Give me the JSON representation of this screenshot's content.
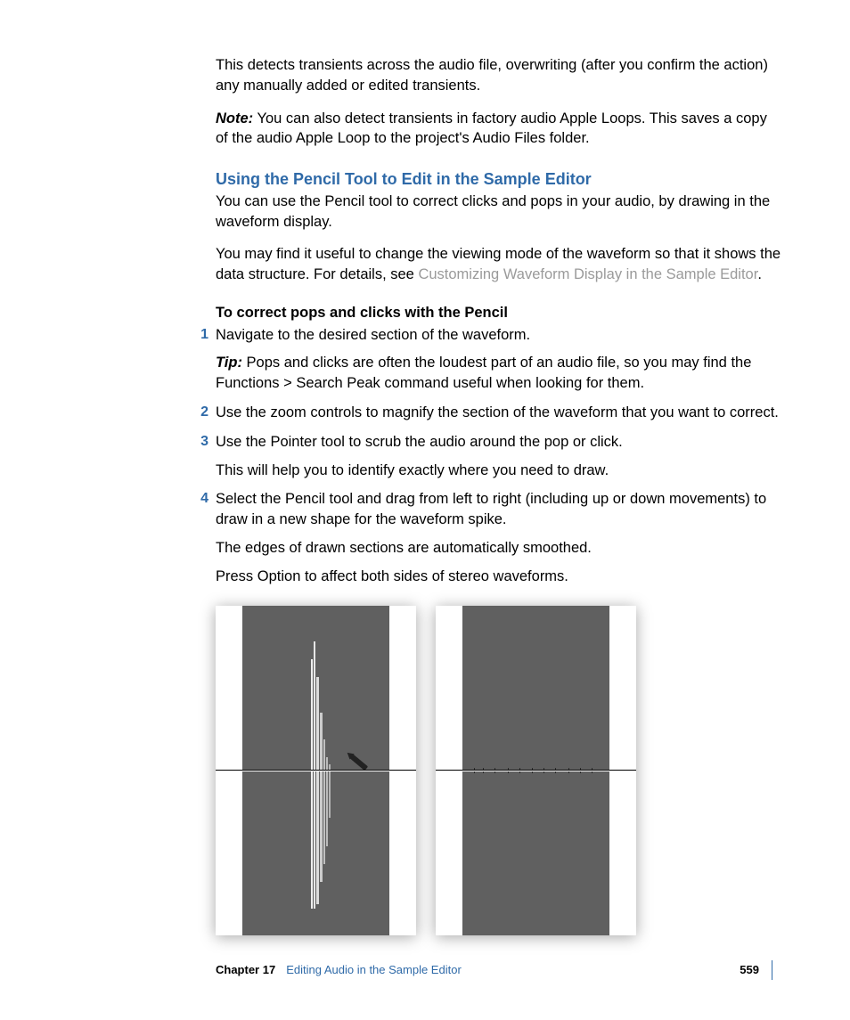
{
  "intro_para": "This detects transients across the audio file, overwriting (after you confirm the action) any manually added or edited transients.",
  "note": {
    "label": "Note:",
    "text": " You can also detect transients in factory audio Apple Loops. This saves a copy of the audio Apple Loop to the project's Audio Files folder."
  },
  "section_heading": "Using the Pencil Tool to Edit in the Sample Editor",
  "section_p1": "You can use the Pencil tool to correct clicks and pops in your audio, by drawing in the waveform display.",
  "section_p2_a": "You may find it useful to change the viewing mode of the waveform so that it shows the data structure. For details, see ",
  "section_p2_link": "Customizing Waveform Display in the Sample Editor",
  "section_p2_b": ".",
  "sub_heading": "To correct pops and clicks with the Pencil",
  "steps": [
    {
      "text": "Navigate to the desired section of the waveform.",
      "extras": [
        {
          "tip_label": "Tip:",
          "text": " Pops and clicks are often the loudest part of an audio file, so you may find the Functions > Search Peak command useful when looking for them."
        }
      ]
    },
    {
      "text": "Use the zoom controls to magnify the section of the waveform that you want to correct."
    },
    {
      "text": "Use the Pointer tool to scrub the audio around the pop or click.",
      "extras": [
        {
          "text": "This will help you to identify exactly where you need to draw."
        }
      ]
    },
    {
      "text": "Select the Pencil tool and drag from left to right (including up or down movements) to draw in a new shape for the waveform spike.",
      "extras": [
        {
          "text": "The edges of drawn sections are automatically smoothed."
        },
        {
          "text": "Press Option to affect both sides of stereo waveforms."
        }
      ]
    }
  ],
  "footer": {
    "chapter_label": "Chapter 17",
    "chapter_title": "Editing Audio in the Sample Editor",
    "page_number": "559"
  }
}
